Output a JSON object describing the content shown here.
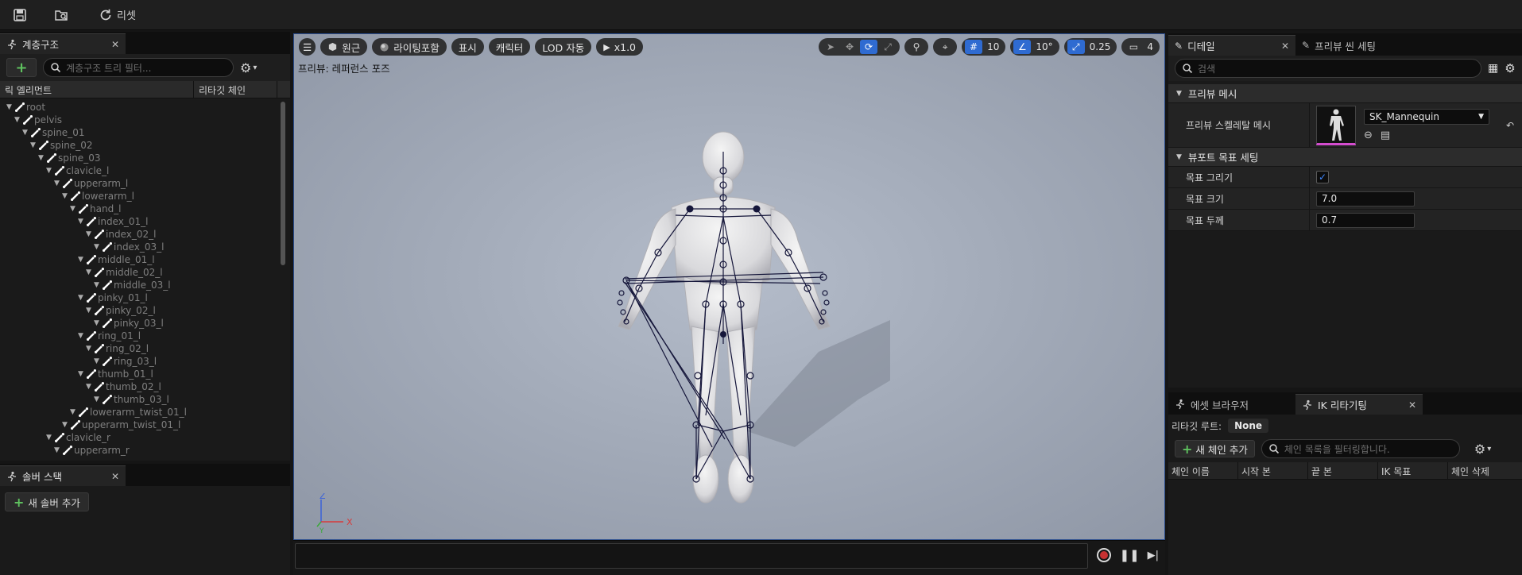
{
  "toolbar": {
    "reset_label": "리셋"
  },
  "hierarchy": {
    "tab_title": "계층구조",
    "search_placeholder": "계층구조 트리 필터...",
    "col_element": "릭 엘리먼트",
    "col_chain": "리타깃 체인",
    "bones": [
      {
        "name": "root",
        "depth": 0
      },
      {
        "name": "pelvis",
        "depth": 1
      },
      {
        "name": "spine_01",
        "depth": 2
      },
      {
        "name": "spine_02",
        "depth": 3
      },
      {
        "name": "spine_03",
        "depth": 4
      },
      {
        "name": "clavicle_l",
        "depth": 5
      },
      {
        "name": "upperarm_l",
        "depth": 6
      },
      {
        "name": "lowerarm_l",
        "depth": 7
      },
      {
        "name": "hand_l",
        "depth": 8
      },
      {
        "name": "index_01_l",
        "depth": 9
      },
      {
        "name": "index_02_l",
        "depth": 10
      },
      {
        "name": "index_03_l",
        "depth": 11
      },
      {
        "name": "middle_01_l",
        "depth": 9
      },
      {
        "name": "middle_02_l",
        "depth": 10
      },
      {
        "name": "middle_03_l",
        "depth": 11
      },
      {
        "name": "pinky_01_l",
        "depth": 9
      },
      {
        "name": "pinky_02_l",
        "depth": 10
      },
      {
        "name": "pinky_03_l",
        "depth": 11
      },
      {
        "name": "ring_01_l",
        "depth": 9
      },
      {
        "name": "ring_02_l",
        "depth": 10
      },
      {
        "name": "ring_03_l",
        "depth": 11
      },
      {
        "name": "thumb_01_l",
        "depth": 9
      },
      {
        "name": "thumb_02_l",
        "depth": 10
      },
      {
        "name": "thumb_03_l",
        "depth": 11
      },
      {
        "name": "lowerarm_twist_01_l",
        "depth": 8
      },
      {
        "name": "upperarm_twist_01_l",
        "depth": 7
      },
      {
        "name": "clavicle_r",
        "depth": 5
      },
      {
        "name": "upperarm_r",
        "depth": 6
      },
      {
        "name": "",
        "depth": 7
      }
    ]
  },
  "solver": {
    "tab_title": "솔버 스택",
    "add_label": "새 솔버 추가"
  },
  "viewport": {
    "btn_perspective": "원근",
    "btn_lighting": "라이팅포함",
    "btn_show": "표시",
    "btn_character": "캐릭터",
    "btn_lod": "LOD 자동",
    "btn_speed": "x1.0",
    "grid_snap": "10",
    "rot_snap": "10°",
    "scale_snap": "0.25",
    "camera_speed": "4",
    "caption": "프리뷰: 레퍼런스 포즈",
    "axis_x": "X",
    "axis_y": "Y",
    "axis_z": "Z"
  },
  "details": {
    "tab_title": "디테일",
    "tab2_title": "프리뷰 씬 세팅",
    "search_placeholder": "검색",
    "section_preview": "프리뷰 메시",
    "label_preview_mesh": "프리뷰 스켈레탈 메시",
    "mesh_value": "SK_Mannequin",
    "section_viewport": "뷰포트 목표 세팅",
    "label_draw": "목표 그리기",
    "label_size": "목표 크기",
    "size_value": "7.0",
    "label_thickness": "목표 두께",
    "thickness_value": "0.7"
  },
  "ik": {
    "tab_asset": "에셋 브라우저",
    "tab_retarget": "IK 리타기팅",
    "root_label": "리타깃 루트:",
    "root_value": "None",
    "add_chain": "새 체인 추가",
    "search_placeholder": "체인 목록을 필터링합니다.",
    "col_chain": "체인 이름",
    "col_start": "시작 본",
    "col_end": "끝 본",
    "col_goal": "IK 목표",
    "col_delete": "체인 삭제"
  }
}
